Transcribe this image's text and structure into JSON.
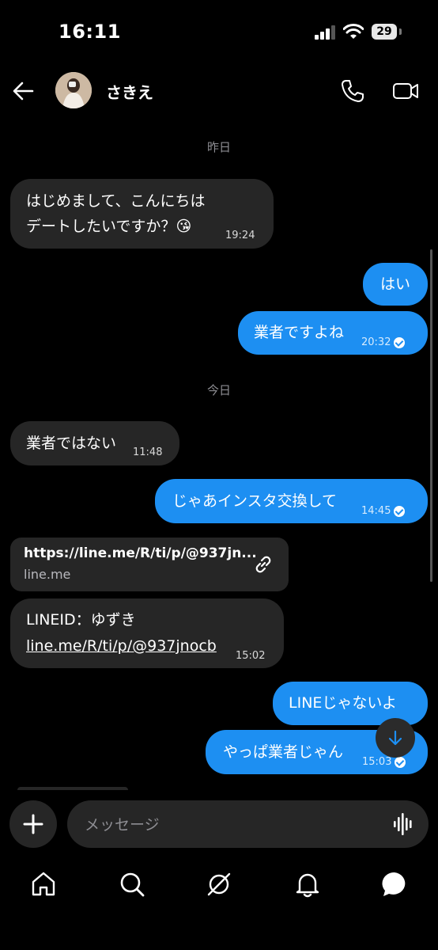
{
  "status": {
    "time": "16:11",
    "battery": "29"
  },
  "header": {
    "name": "さきえ"
  },
  "days": {
    "yesterday": "昨日",
    "today": "今日"
  },
  "messages": {
    "m1_line1": "はじめまして、こんにちは",
    "m1_line2": "デートしたいですか？",
    "m1_emoji": "😘",
    "m1_time": "19:24",
    "m2_text": "はい",
    "m3_text": "業者ですよね",
    "m3_time": "20:32",
    "m4_text": "業者ではない",
    "m4_time": "11:48",
    "m5_text": "じゃあインスタ交換して",
    "m5_time": "14:45",
    "link_url": "https://line.me/R/ti/p/@937jn...",
    "link_domain": "line.me",
    "m6_line1": "LINEID：ゆずき",
    "m6_link": "line.me/R/ti/p/@937jnocb",
    "m6_time": "15:02",
    "m7_text": "LINEじゃないよ",
    "m8_text": "やっぱ業者じゃん",
    "m8_time": "15:03"
  },
  "composer": {
    "placeholder": "メッセージ"
  },
  "icons": {
    "back": "arrow-left",
    "call": "phone",
    "video": "video-camera",
    "link": "chain-link",
    "down": "arrow-down",
    "plus": "plus",
    "voice": "waveform",
    "nav": [
      "home",
      "search",
      "explore-compass",
      "notifications-bell",
      "messages-bubble"
    ]
  },
  "colors": {
    "outgoing": "#1d8ff2",
    "incoming": "#262626",
    "background": "#000000"
  }
}
